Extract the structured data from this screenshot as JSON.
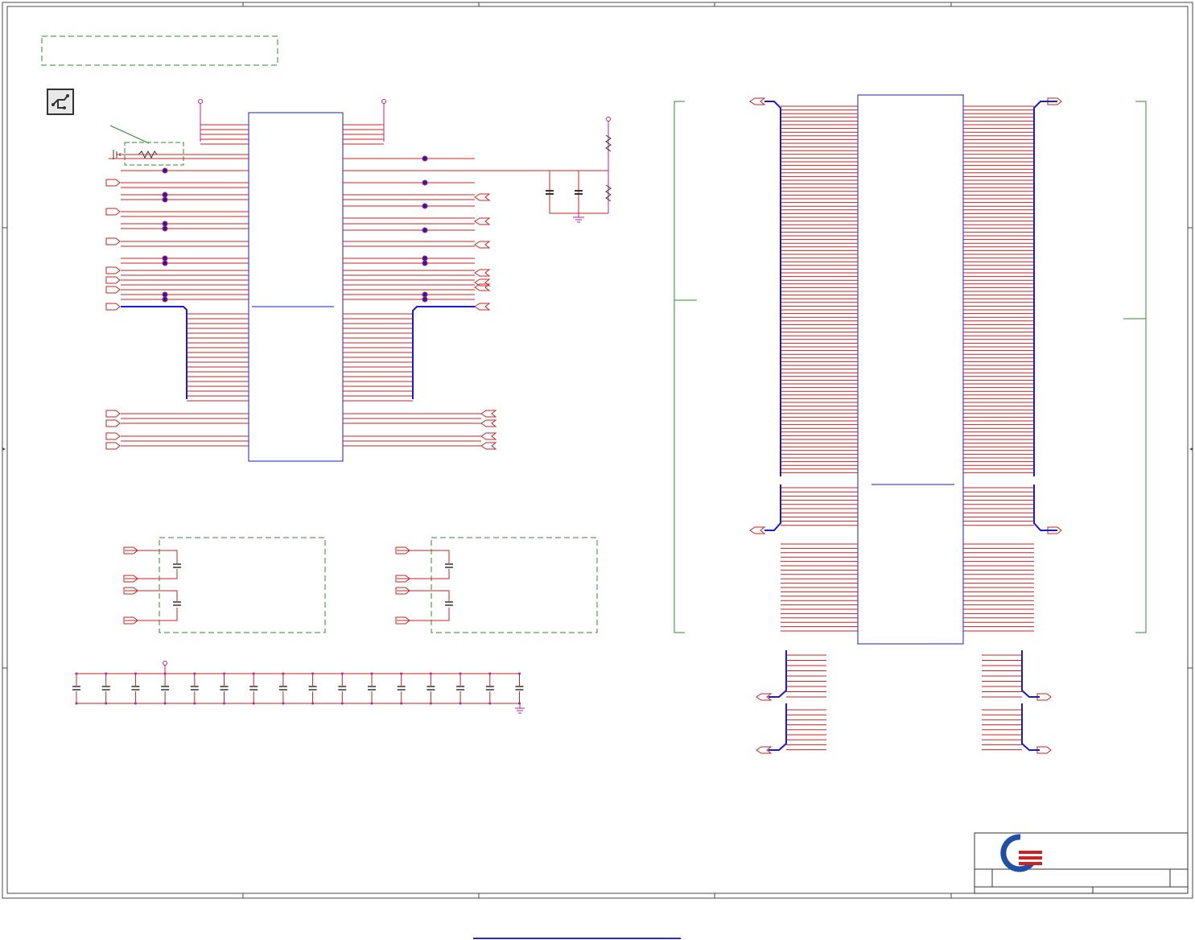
{
  "schematic": {
    "colors": {
      "frame": "#4a4a4a",
      "net_wire": "#cc2222",
      "bus_wire": "#1a1ad6",
      "component_outline": "#1a1ad6",
      "note_box": "#2e8b2e",
      "power_symbol": "#c0208a",
      "junction_dot": "#1a1ad6",
      "logo_blue": "#1f4fa8",
      "logo_red": "#d02020"
    },
    "icons": {
      "sheet_badge": "schematic-badge-icon",
      "title_logo": "company-logo-icon"
    }
  }
}
